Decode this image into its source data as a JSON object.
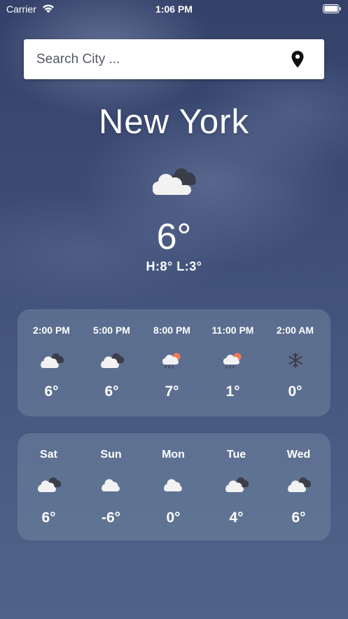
{
  "status_bar": {
    "carrier": "Carrier",
    "time": "1:06 PM",
    "wifi_icon": "wifi-icon",
    "battery_icon": "battery-icon"
  },
  "search": {
    "placeholder": "Search City ...",
    "value": "",
    "icon": "location-pin-icon"
  },
  "current": {
    "city": "New York",
    "icon": "cloudy-icon",
    "temperature": "6°",
    "high_low": "H:8°  L:3°"
  },
  "hourly": [
    {
      "time": "2:00 PM",
      "icon": "cloudy-icon",
      "temp": "6°"
    },
    {
      "time": "5:00 PM",
      "icon": "cloudy-icon",
      "temp": "6°"
    },
    {
      "time": "8:00 PM",
      "icon": "rain-sun-icon",
      "temp": "7°"
    },
    {
      "time": "11:00 PM",
      "icon": "rain-sun-icon",
      "temp": "1°"
    },
    {
      "time": "2:00 AM",
      "icon": "snowflake-icon",
      "temp": "0°"
    }
  ],
  "daily": [
    {
      "day": "Sat",
      "icon": "cloudy-icon",
      "temp": "6°"
    },
    {
      "day": "Sun",
      "icon": "light-cloud-icon",
      "temp": "-6°"
    },
    {
      "day": "Mon",
      "icon": "light-cloud-icon",
      "temp": "0°"
    },
    {
      "day": "Tue",
      "icon": "cloudy-icon",
      "temp": "4°"
    },
    {
      "day": "Wed",
      "icon": "cloudy-icon",
      "temp": "6°"
    }
  ],
  "colors": {
    "background_top": "#34426a",
    "background_bottom": "#4f6389",
    "card": "#70849e",
    "sun": "#f07a55",
    "dark_cloud": "#3b3e48"
  }
}
